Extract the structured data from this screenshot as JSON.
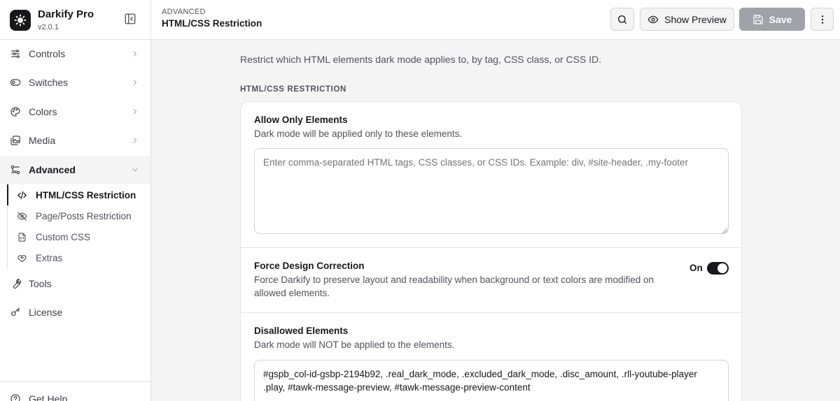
{
  "app": {
    "name": "Darkify Pro",
    "version": "v2.0.1"
  },
  "sidebar": {
    "items": [
      {
        "label": "Controls",
        "icon": "sliders-icon"
      },
      {
        "label": "Switches",
        "icon": "toggle-icon"
      },
      {
        "label": "Colors",
        "icon": "palette-icon"
      },
      {
        "label": "Media",
        "icon": "image-icon"
      },
      {
        "label": "Advanced",
        "icon": "settings-alt-icon",
        "active": true
      }
    ],
    "subitems": [
      {
        "label": "HTML/CSS Restriction",
        "icon": "code-icon",
        "active": true
      },
      {
        "label": "Page/Posts Restriction",
        "icon": "eye-off-icon"
      },
      {
        "label": "Custom CSS",
        "icon": "file-code-icon"
      },
      {
        "label": "Extras",
        "icon": "heart-icon"
      }
    ],
    "bottom_items": [
      {
        "label": "Tools",
        "icon": "wrench-icon"
      },
      {
        "label": "License",
        "icon": "key-icon"
      }
    ],
    "help_label": "Get Help"
  },
  "header": {
    "breadcrumb": "ADVANCED",
    "title": "HTML/CSS Restriction",
    "preview_label": "Show Preview",
    "save_label": "Save"
  },
  "main": {
    "description": "Restrict which HTML elements dark mode applies to, by tag, CSS class, or CSS ID.",
    "section_label": "HTML/CSS RESTRICTION",
    "allow": {
      "title": "Allow Only Elements",
      "help": "Dark mode will be applied only to these elements.",
      "placeholder": "Enter comma-separated HTML tags, CSS classes, or CSS IDs. Example: div, #site-header, .my-footer",
      "value": ""
    },
    "force": {
      "title": "Force Design Correction",
      "help": "Force Darkify to preserve layout and readability when background or text colors are modified on allowed elements.",
      "toggle_label": "On",
      "enabled": true
    },
    "disallow": {
      "title": "Disallowed Elements",
      "help": "Dark mode will NOT be applied to the elements.",
      "value": "#gspb_col-id-gsbp-2194b92, .real_dark_mode, .excluded_dark_mode, .disc_amount, .rll-youtube-player .play, #tawk-message-preview, #tawk-message-preview-content"
    }
  },
  "colors": {
    "accent": "#18181b",
    "muted_text": "#52525b",
    "border": "#e4e4e7",
    "save_disabled": "#a1a1aa",
    "canvas": "#f4f4f5"
  }
}
